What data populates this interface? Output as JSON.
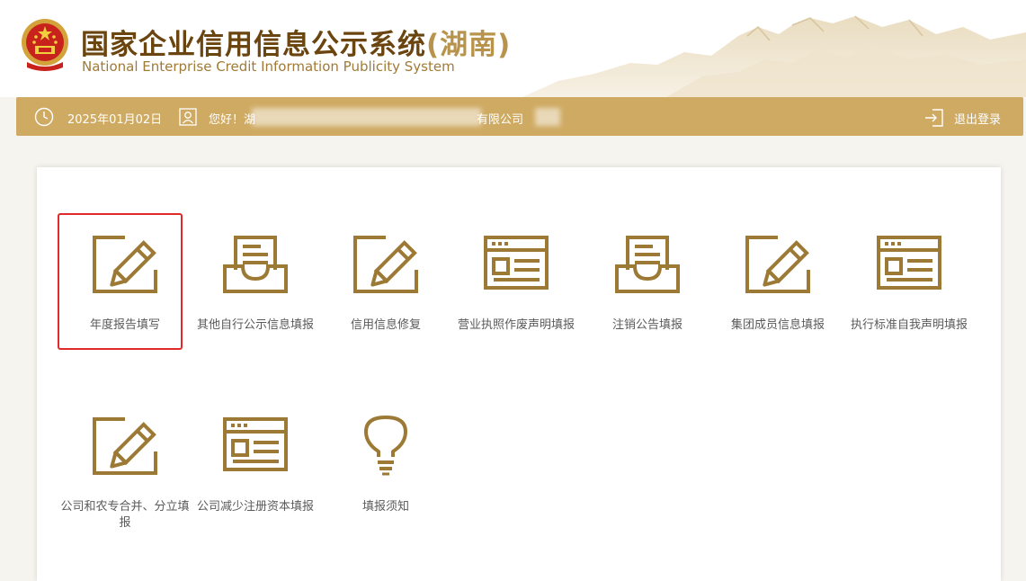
{
  "header": {
    "title_zh": "国家企业信用信息公示系统",
    "region": "(湖南)",
    "title_en": "National Enterprise Credit Information Publicity System"
  },
  "status_bar": {
    "date": "2025年01月02日",
    "greeting": "您好！湖",
    "company_suffix": "有限公司",
    "logout": "退出登录"
  },
  "menu": {
    "selected_index": 0,
    "items": [
      {
        "label": "年度报告填写",
        "icon": "pencil-edit-icon"
      },
      {
        "label": "其他自行公示信息填报",
        "icon": "document-tray-icon"
      },
      {
        "label": "信用信息修复",
        "icon": "pencil-edit-icon"
      },
      {
        "label": "营业执照作废声明填报",
        "icon": "web-form-icon"
      },
      {
        "label": "注销公告填报",
        "icon": "document-tray-icon"
      },
      {
        "label": "集团成员信息填报",
        "icon": "pencil-edit-icon"
      },
      {
        "label": "执行标准自我声明填报",
        "icon": "web-form-icon"
      },
      {
        "label": "公司和农专合并、分立填报",
        "icon": "pencil-edit-icon"
      },
      {
        "label": "公司减少注册资本填报",
        "icon": "web-form-icon"
      },
      {
        "label": "填报须知",
        "icon": "lightbulb-icon"
      }
    ]
  },
  "colors": {
    "icon_gold": "#9c7a36",
    "bar_gold": "#cfaa62",
    "title_brown": "#6b4510",
    "highlight_red": "#e32a2a"
  }
}
